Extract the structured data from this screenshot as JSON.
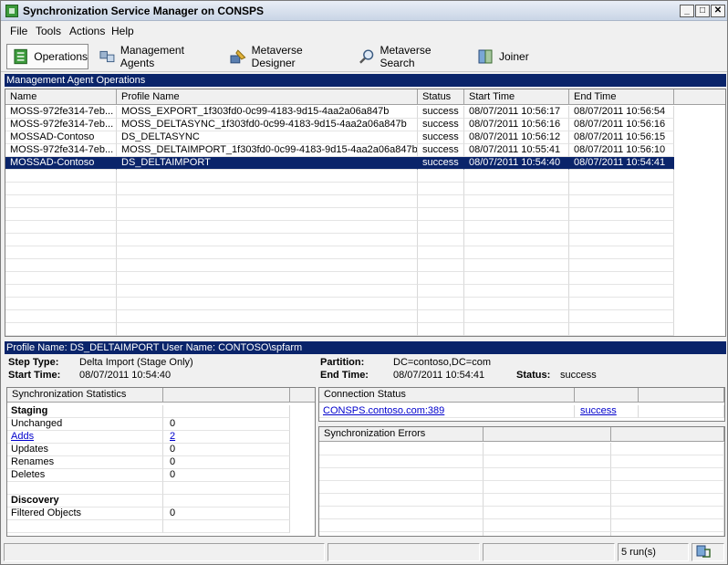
{
  "window": {
    "title": "Synchronization Service Manager on CONSPS"
  },
  "menu": [
    "File",
    "Tools",
    "Actions",
    "Help"
  ],
  "toolbar": {
    "operations": "Operations",
    "management_agents": "Management Agents",
    "metaverse_designer": "Metaverse Designer",
    "metaverse_search": "Metaverse Search",
    "joiner": "Joiner"
  },
  "operations_section": {
    "title": "Management Agent Operations",
    "columns": [
      "Name",
      "Profile Name",
      "Status",
      "Start Time",
      "End Time"
    ],
    "rows": [
      [
        "MOSS-972fe314-7eb...",
        "MOSS_EXPORT_1f303fd0-0c99-4183-9d15-4aa2a06a847b",
        "success",
        "08/07/2011 10:56:17",
        "08/07/2011 10:56:54"
      ],
      [
        "MOSS-972fe314-7eb...",
        "MOSS_DELTASYNC_1f303fd0-0c99-4183-9d15-4aa2a06a847b",
        "success",
        "08/07/2011 10:56:16",
        "08/07/2011 10:56:16"
      ],
      [
        "MOSSAD-Contoso",
        "DS_DELTASYNC",
        "success",
        "08/07/2011 10:56:12",
        "08/07/2011 10:56:15"
      ],
      [
        "MOSS-972fe314-7eb...",
        "MOSS_DELTAIMPORT_1f303fd0-0c99-4183-9d15-4aa2a06a847b",
        "success",
        "08/07/2011 10:55:41",
        "08/07/2011 10:56:10"
      ],
      [
        "MOSSAD-Contoso",
        "DS_DELTAIMPORT",
        "success",
        "08/07/2011 10:54:40",
        "08/07/2011 10:54:41"
      ]
    ],
    "selected_row": 4
  },
  "profile_bar": "Profile Name: DS_DELTAIMPORT  User Name: CONTOSO\\spfarm",
  "details": {
    "step_type_label": "Step Type:",
    "step_type": "Delta Import (Stage Only)",
    "start_time_label": "Start Time:",
    "start_time": "08/07/2011 10:54:40",
    "partition_label": "Partition:",
    "partition": "DC=contoso,DC=com",
    "end_time_label": "End Time:",
    "end_time": "08/07/2011 10:54:41",
    "status_label": "Status:",
    "status": "success"
  },
  "sync_stats": {
    "header": "Synchronization Statistics",
    "staging_label": "Staging",
    "items": [
      {
        "label": "Unchanged",
        "value": "0",
        "link": false
      },
      {
        "label": "Adds",
        "value": "2",
        "link": true
      },
      {
        "label": "Updates",
        "value": "0",
        "link": false
      },
      {
        "label": "Renames",
        "value": "0",
        "link": false
      },
      {
        "label": "Deletes",
        "value": "0",
        "link": false
      }
    ],
    "discovery_label": "Discovery",
    "discovery_items": [
      {
        "label": "Filtered Objects",
        "value": "0"
      }
    ]
  },
  "connection_status": {
    "header": "Connection Status",
    "server": "CONSPS.contoso.com:389",
    "result": "success"
  },
  "sync_errors": {
    "header": "Synchronization Errors"
  },
  "statusbar": {
    "runs": "5 run(s)"
  }
}
